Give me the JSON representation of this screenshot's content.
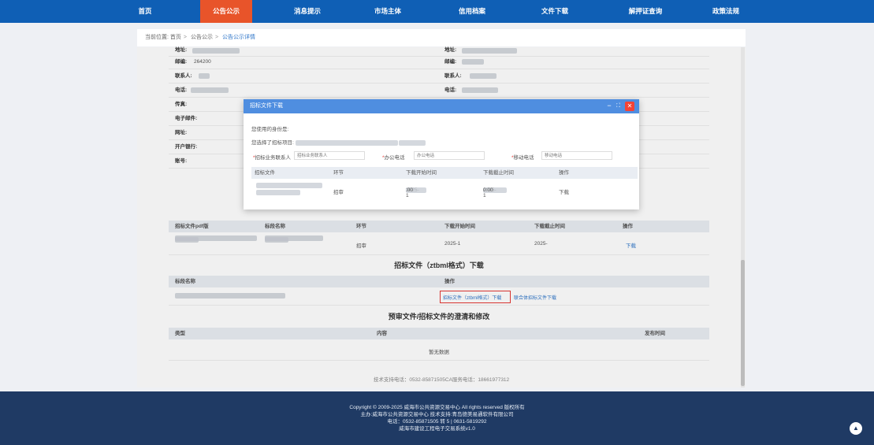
{
  "nav": {
    "items": [
      "首页",
      "公告公示",
      "消息提示",
      "市场主体",
      "信用档案",
      "文件下载",
      "解押证查询",
      "政策法规"
    ],
    "active_index": 1
  },
  "breadcrumb": {
    "label": "当前位置:",
    "home": "首页",
    "section": "公告公示",
    "current": "公告公示详情"
  },
  "info": {
    "left": {
      "address_label": "地址:",
      "zip_label": "邮编:",
      "zip_value": "264200",
      "contact_label": "联系人:",
      "phone_label": "电话:",
      "fax_label": "传真:",
      "email_label": "电子邮件:",
      "web_label": "网址:",
      "bank_label": "开户银行:",
      "account_label": "账号:"
    },
    "right": {
      "address_label": "地址:",
      "zip_label": "邮编:",
      "contact_label": "联系人:",
      "phone_label": "电话:"
    }
  },
  "pdf_table": {
    "headers": [
      "招标文件pdf版",
      "标段名称",
      "环节",
      "下载开始时间",
      "下载截止时间",
      "操作"
    ],
    "row": {
      "stage": "招审",
      "start": "2025-1",
      "end": "2025-",
      "action": "下载"
    }
  },
  "ztbml_section": {
    "title": "招标文件（ztbml格式）下载",
    "headers": [
      "标段名称",
      "操作"
    ],
    "download_link": "招标文件（ztbml格式）下载",
    "joint_link": "联合体招标文件下载"
  },
  "clarify_section": {
    "title": "预审文件/招标文件的澄清和修改",
    "headers": [
      "类型",
      "内容",
      "发布时间"
    ],
    "empty": "暂无数据"
  },
  "support": "技术支持电话：0532-85871505CA服务电话：18661977312",
  "footer": {
    "line1": "Copyright © 2009-2025  威海市公共资源交易中心  All rights reserved 版权所有",
    "line2": "主办:威海市公共资源交易中心  技术支持:青岛德美易通软件有限公司",
    "line3": "电话：0532-85871505 转 5 | 0631-5819292",
    "line4": "威海市建设工程电子交易系统v1.0"
  },
  "modal": {
    "title": "招标文件下载",
    "identity_label": "您使用的身份是:",
    "project_label": "您选择了招标项目:",
    "fields": {
      "contact_label": "招标业务联系人",
      "contact_placeholder": "招标业务联系人",
      "office_label": "办公电话",
      "office_placeholder": "办公电话",
      "mobile_label": "移动电话",
      "mobile_placeholder": "移动电话"
    },
    "table_headers": [
      "招标文件",
      "环节",
      "下载开始时间",
      "下载截止时间",
      "操作"
    ],
    "row": {
      "stage": "招审",
      "start": "2025-1",
      "start_tail": ":00",
      "end": "2025-1",
      "end_tail": "0:00",
      "action": "下载"
    },
    "controls": {
      "minimize": "−",
      "maximize": "⛶",
      "close": "✕"
    }
  },
  "icons": {
    "back_to_top": "back-to-top-icon"
  },
  "colors": {
    "nav_bg": "#0f5fb5",
    "nav_active": "#e8542a",
    "modal_header": "#4f8ee0",
    "link": "#2f76c9",
    "highlight": "#e53935",
    "footer_bg": "#1f3a64"
  }
}
